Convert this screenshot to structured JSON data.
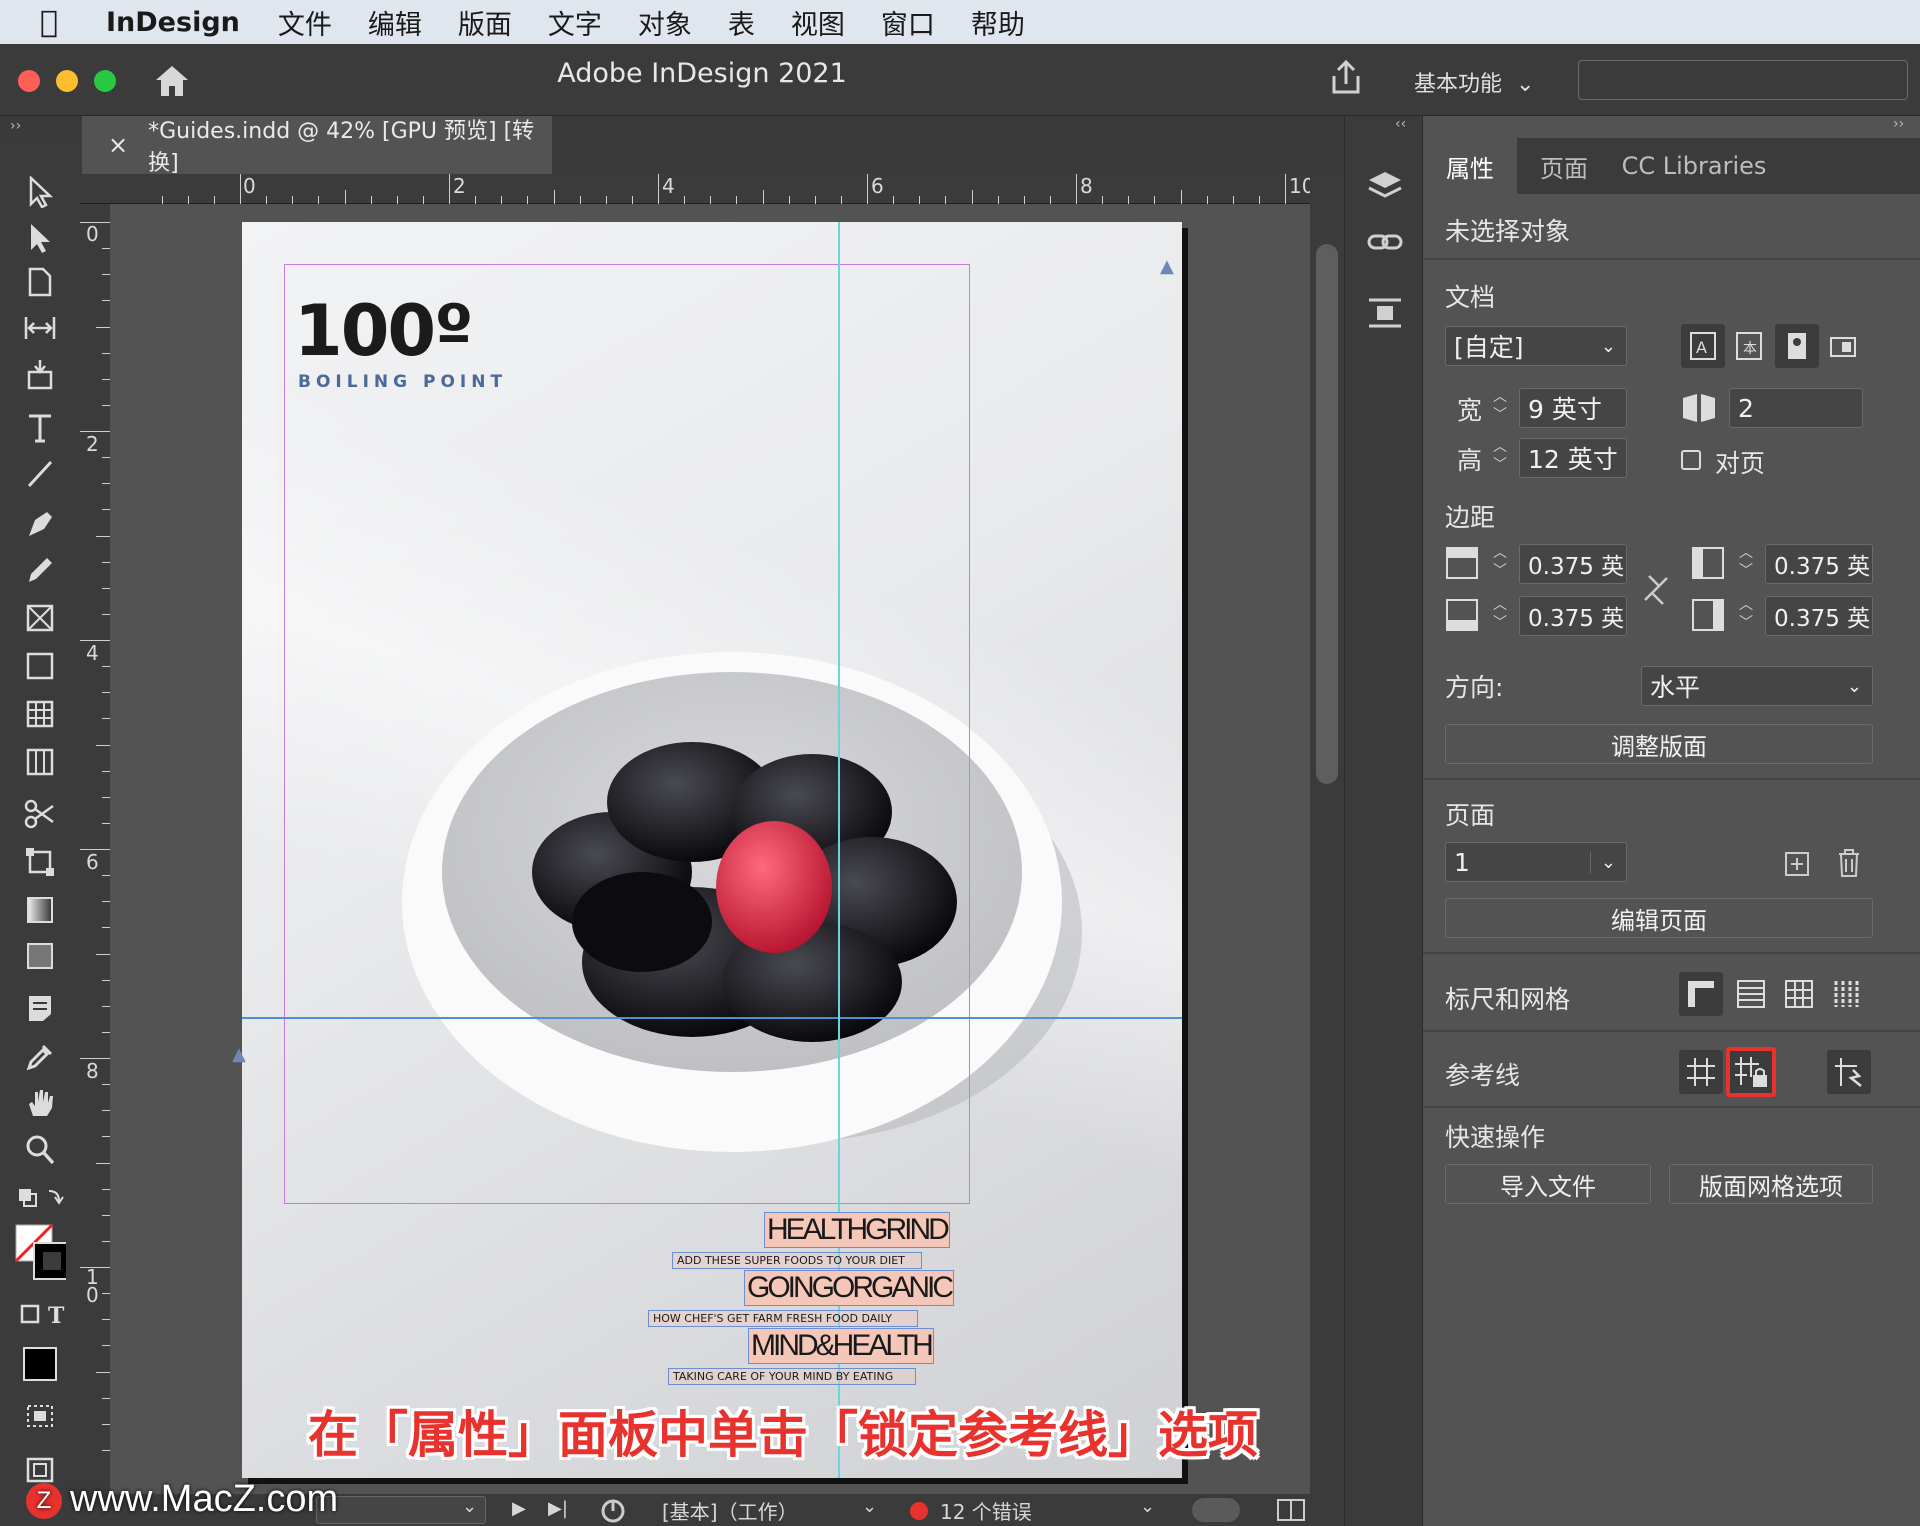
{
  "menubar": {
    "app_name": "InDesign",
    "items": [
      "文件",
      "编辑",
      "版面",
      "文字",
      "对象",
      "表",
      "视图",
      "窗口",
      "帮助"
    ]
  },
  "window": {
    "title": "Adobe InDesign 2021",
    "workspace": "基本功能",
    "traffic_colors": [
      "#ff5f57",
      "#febc2e",
      "#28c840"
    ]
  },
  "document_tab": {
    "close_glyph": "×",
    "label": "*Guides.indd @ 42% [GPU 预览] [转换]"
  },
  "ruler": {
    "horizontal": [
      "0",
      "2",
      "4",
      "6",
      "8",
      "10"
    ],
    "vertical": [
      "0",
      "2",
      "4",
      "6",
      "8",
      "1\n0"
    ]
  },
  "page_content": {
    "logo": "100º",
    "tagline": "BOILING POINT",
    "headlines": [
      {
        "title": "HEALTHGRIND",
        "sub": "ADD THESE SUPER FOODS TO YOUR DIET"
      },
      {
        "title": "GOINGORGANIC",
        "sub": "HOW CHEF'S GET FARM FRESH FOOD DAILY"
      },
      {
        "title": "MIND&HEALTH",
        "sub": "TAKING CARE OF YOUR MIND BY EATING"
      }
    ]
  },
  "panel": {
    "tabs": [
      "属性",
      "页面",
      "CC Libraries"
    ],
    "selection_status": "未选择对象",
    "document_section": "文档",
    "preset": "[自定]",
    "width_label": "宽",
    "width_value": "9 英寸",
    "height_label": "高",
    "height_value": "12 英寸",
    "pages_count": "2",
    "facing_pages_label": "对页",
    "margins_section": "边距",
    "margin_top": "0.375 英",
    "margin_bottom": "0.375 英",
    "margin_left": "0.375 英",
    "margin_right": "0.375 英",
    "orientation_label": "方向:",
    "orientation_value": "水平",
    "adjust_layout_button": "调整版面",
    "pages_section": "页面",
    "page_value": "1",
    "edit_page_button": "编辑页面",
    "rulers_grids_section": "标尺和网格",
    "guides_section": "参考线",
    "quick_actions_section": "快速操作",
    "import_file_button": "导入文件",
    "layout_grid_button": "版面网格选项",
    "highlight_color": "#e8322d"
  },
  "statusbar": {
    "preflight_profile": "[基本]（工作）",
    "errors": "12 个错误"
  },
  "caption": "在「属性」面板中单击「锁定参考线」选项",
  "watermark": "www.MacZ.com"
}
